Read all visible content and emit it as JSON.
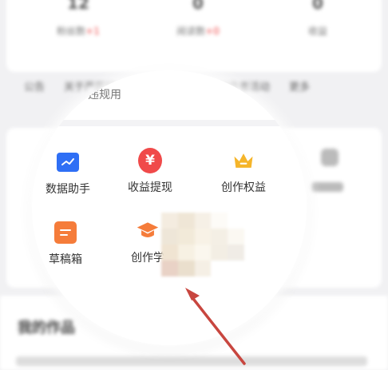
{
  "background": {
    "stats": [
      {
        "num": "12",
        "label": "粉丝数",
        "delta": "+1"
      },
      {
        "num": "0",
        "label": "阅读数",
        "delta": "+0"
      },
      {
        "num": "0",
        "label": "收益"
      }
    ],
    "row": [
      "公告",
      "关于严厉打击违规问题的通知",
      "创作者活动",
      "更多"
    ],
    "section_title": "我的作品"
  },
  "magnifier": {
    "partial_text": "违规用",
    "tools": [
      {
        "label": "数据助手",
        "icon": "chart-icon"
      },
      {
        "label": "收益提现",
        "icon": "yuan-icon"
      },
      {
        "label": "创作权益",
        "icon": "crown-icon"
      },
      {
        "label": "草稿箱",
        "icon": "draft-icon"
      },
      {
        "label": "创作学",
        "icon": "graduation-cap-icon"
      }
    ]
  },
  "colors": {
    "data_icon": "#2f6ff5",
    "money_icon": "#f04a4a",
    "crown_icon": "#f5b52a",
    "draft_icon": "#f57c3a",
    "cap_icon": "#f57c3a",
    "arrow": "#c8463f"
  }
}
